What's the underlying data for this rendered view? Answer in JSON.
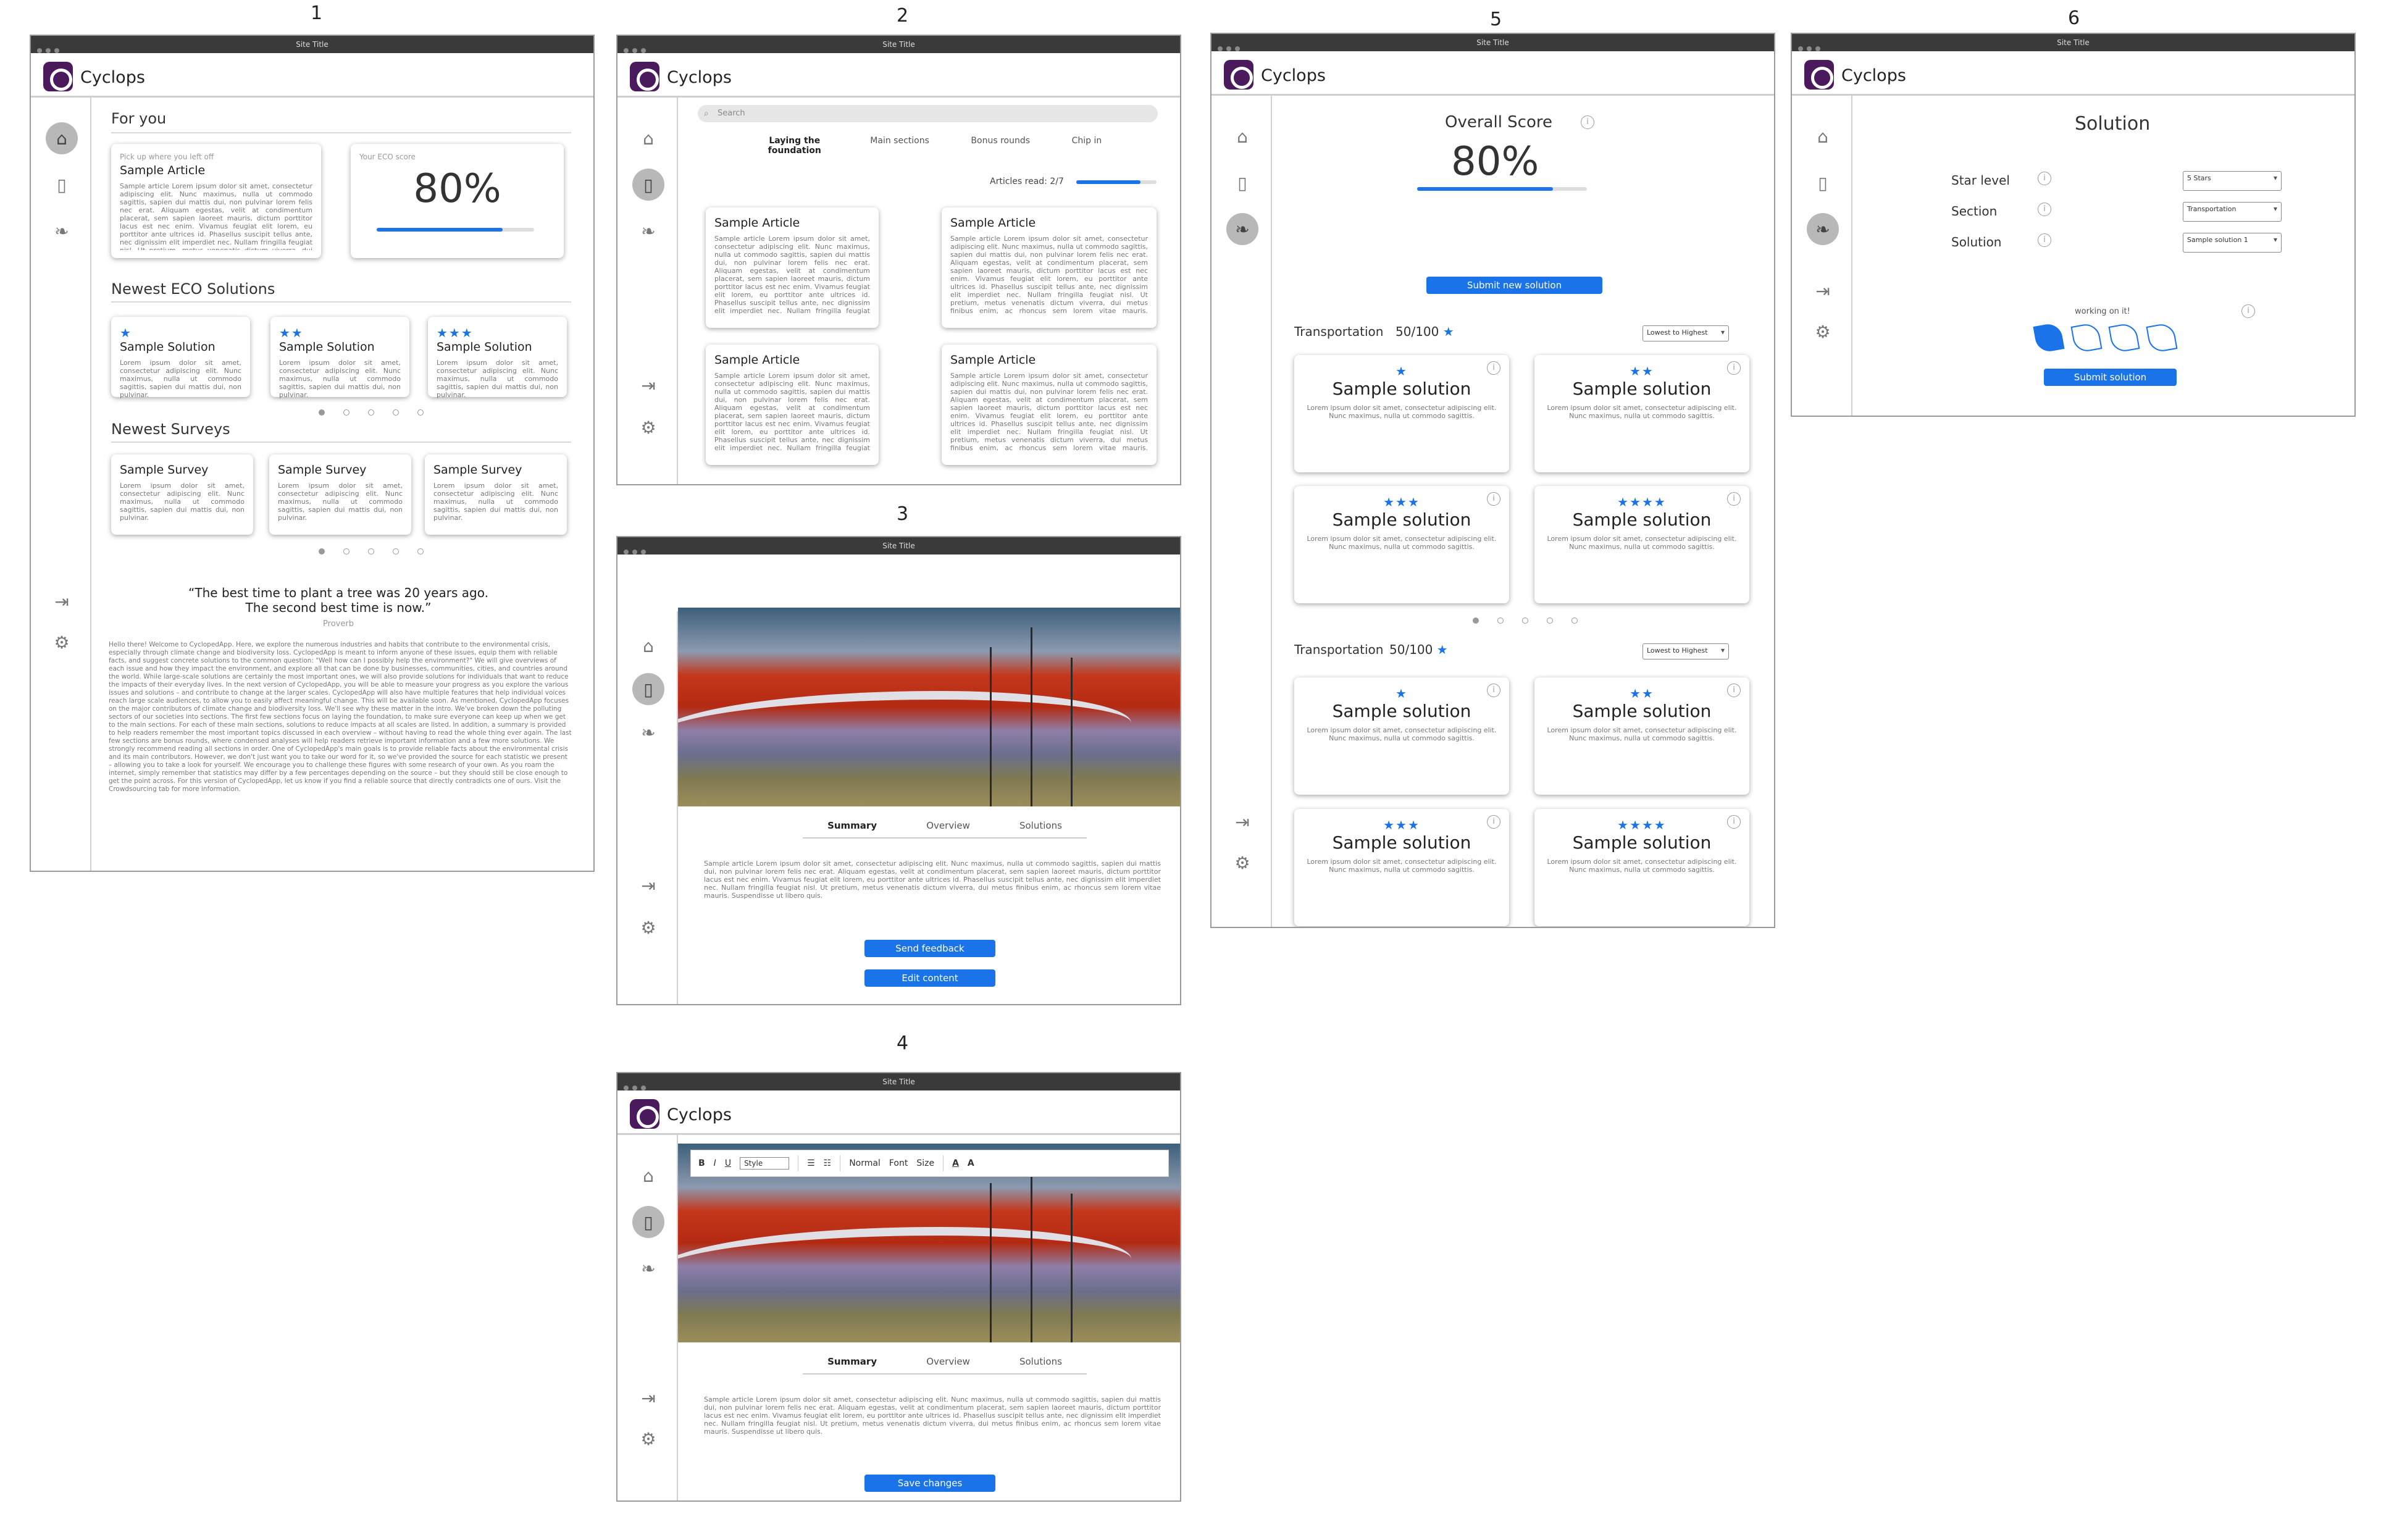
{
  "frames": [
    "1",
    "2",
    "3",
    "4",
    "5",
    "6"
  ],
  "site_title": "Site Title",
  "brand": "Cyclops",
  "colors": {
    "accent": "#1a73e8",
    "logo": "#4a1a5c"
  },
  "nav_icons": [
    "home-icon",
    "book-icon",
    "leaf-icon",
    "login-icon",
    "gear-icon"
  ],
  "lorem_short": "Sample article Lorem ipsum dolor sit amet, consectetur adipiscing elit. Nunc maximus, nulla ut commodo sagittis, sapien dui mattis dui, non pulvinar lorem felis nec erat. Aliquam egestas, velit at condimentum placerat, sem sapien laoreet mauris, dictum porttitor lacus est nec enim. Vivamus feugiat elit lorem, eu porttitor ante ultrices id. Phasellus suscipit tellus ante, nec dignissim elit imperdiet nec. Nullam fringilla feugiat nisl. Ut pretium, metus venenatis dictum viverra, dui metus finibus enim, ac rhoncus sem lorem vitae mauris. Suspendisse ut libero quis.",
  "lorem_card": "Lorem ipsum dolor sit amet, consectetur adipiscing elit. Nunc maximus, nulla ut commodo sagittis, sapien dui mattis dui, non pulvinar.",
  "lorem_sol": "Lorem ipsum dolor sit amet, consectetur adipiscing elit. Nunc maximus, nulla ut commodo sagittis.",
  "f1": {
    "for_you": "For you",
    "pick_up": "Pick up where you left off",
    "sample_article": "Sample Article",
    "eco_score_label": "Your ECO score",
    "eco_score": "80%",
    "eco_progress": 0.8,
    "newest_solutions": "Newest ECO Solutions",
    "sample_solution": "Sample Solution",
    "newest_surveys": "Newest Surveys",
    "sample_survey": "Sample Survey",
    "quote": "“The best time to plant a tree was 20 years ago. The second best time is now.”",
    "quote_source": "Proverb",
    "intro": "Hello there! Welcome to CyclopedApp. Here, we explore the numerous industries and habits that contribute to the environmental crisis, especially through climate change and biodiversity loss. CyclopedApp is meant to inform anyone of these issues, equip them with reliable facts, and suggest concrete solutions to the common question: \"Well how can I possibly help the environment?\" We will give overviews of each issue and how they impact the environment, and explore all that can be done by businesses, communities, cities, and countries around the world. While large-scale solutions are certainly the most important ones, we will also provide solutions for individuals that want to reduce the impacts of their everyday lives. In the next version of CyclopedApp, you will be able to measure your progress as you explore the various issues and solutions – and contribute to change at the larger scales. CyclopedApp will also have multiple features that help individual voices reach large scale audiences, to allow you to easily affect meaningful change. This will be available soon. As mentioned, CyclopedApp focuses on the major contributors of climate change and biodiversity loss. We'll see why these matter in the intro. We've broken down the polluting sectors of our societies into sections. The first few sections focus on laying the foundation, to make sure everyone can keep up when we get to the main sections. For each of these main sections, solutions to reduce impacts at all scales are listed. In addition, a summary is provided to help readers remember the most important topics discussed in each overview – without having to read the whole thing ever again. The last few sections are bonus rounds, where condensed analyses will help readers retrieve important information and a few more solutions. We strongly recommend reading all sections in order. One of CyclopedApp's main goals is to provide reliable facts about the environmental crisis and its main contributors. However, we don't just want you to take our word for it, so we've provided the source for each statistic we present – allowing you to take a look for yourself. We encourage you to challenge these figures with some research of your own. As you roam the internet, simply remember that statistics may differ by a few percentages depending on the source – but they should still be close enough to get the point across. For this version of CyclopedApp, let us know if you find a reliable source that directly contradicts one of ours. Visit the Crowdsourcing tab for more information."
  },
  "f2": {
    "search_placeholder": "Search",
    "tabs": [
      "Laying the foundation",
      "Main sections",
      "Bonus rounds",
      "Chip in"
    ],
    "articles_read": "Articles read: 2/7",
    "read_progress": 0.857,
    "sample_article": "Sample Article"
  },
  "f3": {
    "tabs": [
      "Summary",
      "Overview",
      "Solutions"
    ],
    "send_feedback": "Send feedback",
    "edit_content": "Edit content"
  },
  "f4": {
    "toolbar": {
      "bold": "B",
      "italic": "I",
      "underline": "U",
      "style": "Style",
      "normal": "Normal",
      "font": "Font",
      "size": "Size",
      "font_color": "A",
      "highlight": "A"
    },
    "tabs": [
      "Summary",
      "Overview",
      "Solutions"
    ],
    "save_changes": "Save changes"
  },
  "f5": {
    "overall_score": "Overall Score",
    "score": "80%",
    "score_progress": 0.8,
    "submit_new": "Submit new solution",
    "category": "Transportation",
    "cat_score_1": "50/100",
    "cat_score_2": "50/100",
    "sort": "Lowest to Highest",
    "sample_solution": "Sample solution",
    "star_counts": [
      1,
      2,
      3,
      4
    ]
  },
  "f6": {
    "title": "Solution",
    "star_level": "Star level",
    "section": "Section",
    "solution": "Solution",
    "star_value": "5 Stars",
    "section_value": "Transportation",
    "solution_value": "Sample solution 1",
    "working_on_it": "working on it!",
    "submit": "Submit solution",
    "leaves_filled": 1,
    "leaves_total": 4
  }
}
